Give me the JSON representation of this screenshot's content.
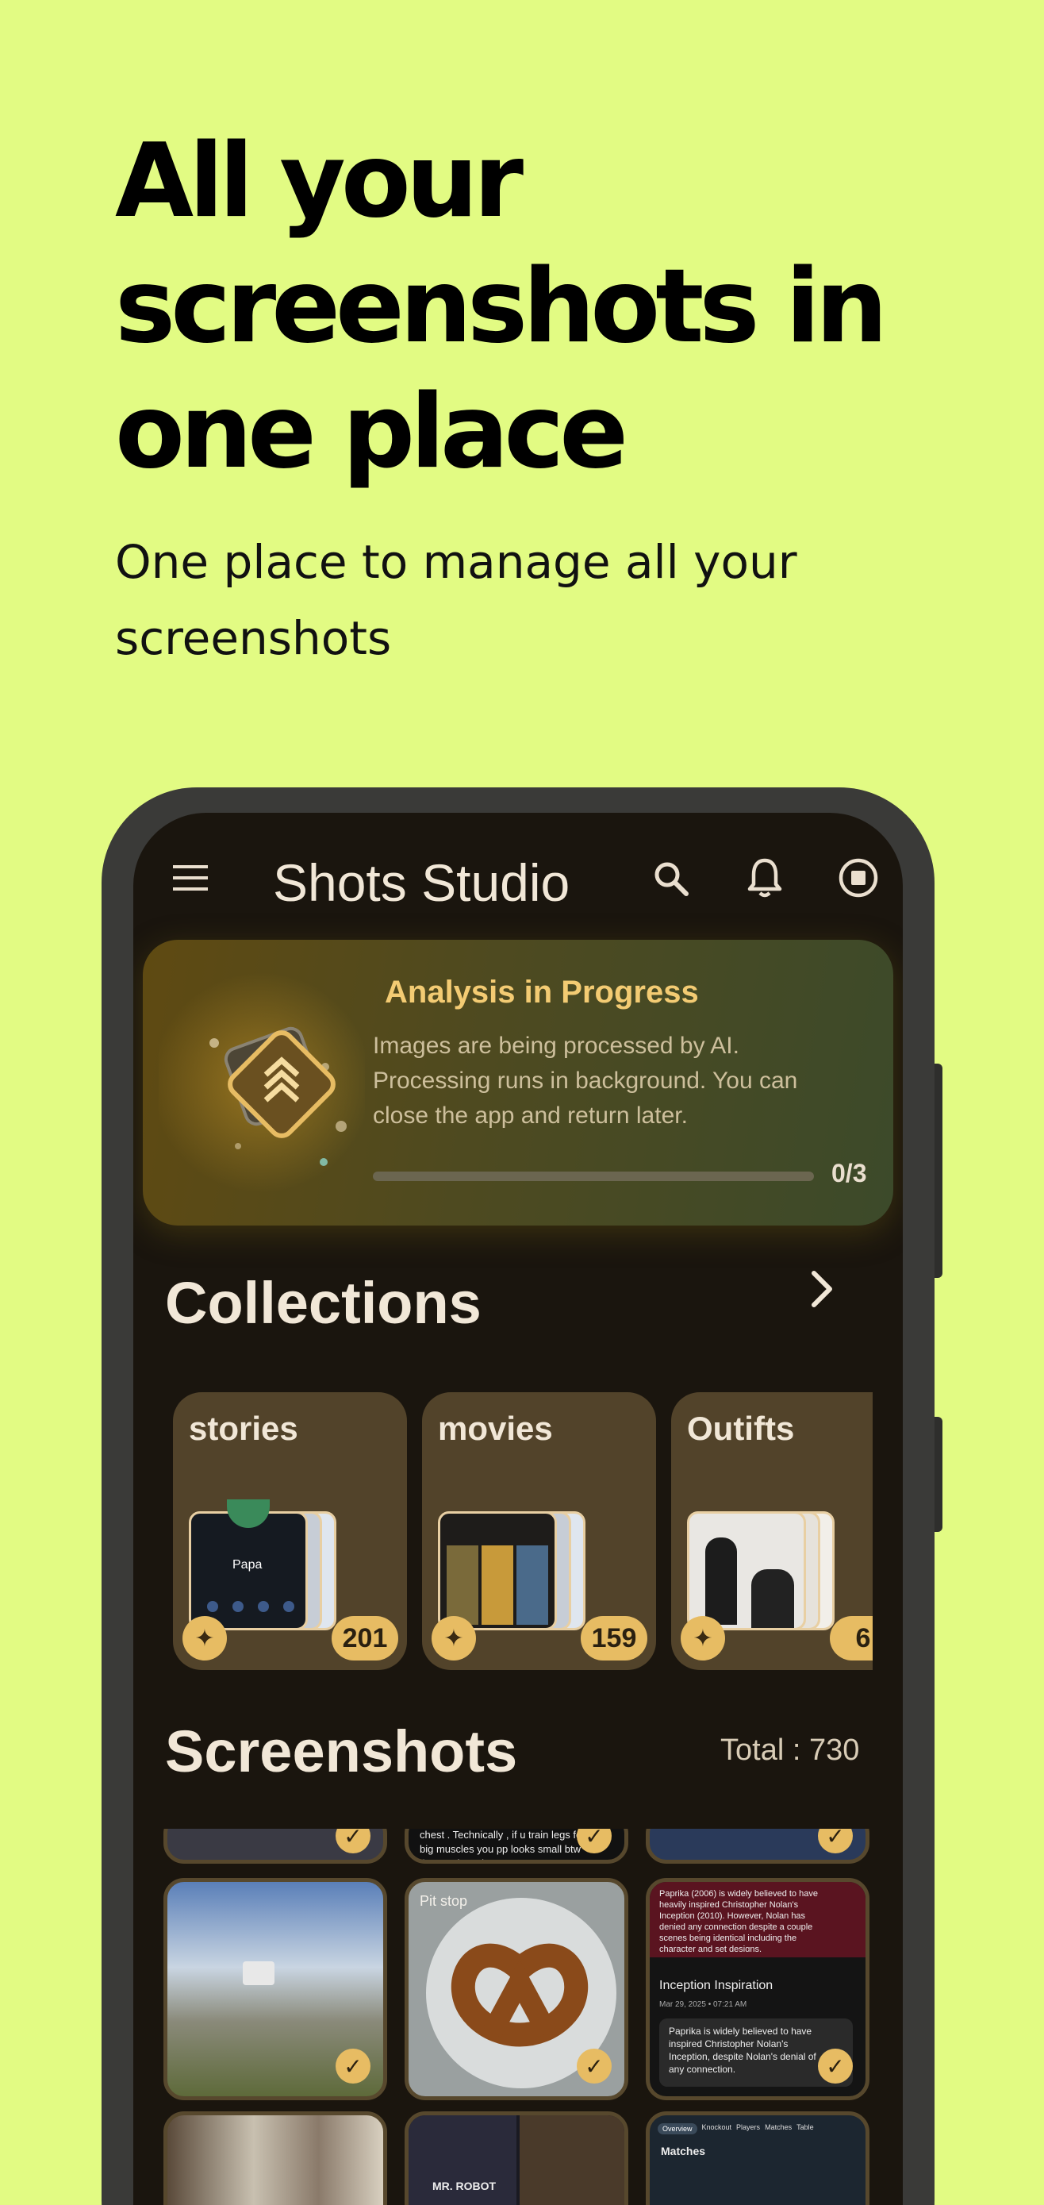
{
  "headline": "All your screenshots in one place",
  "subheadline": "One place to manage all your screenshots",
  "app": {
    "title": "Shots Studio",
    "icons": [
      "menu-icon",
      "search-icon",
      "notification-bell-icon",
      "stop-icon"
    ]
  },
  "analysis": {
    "title": "Analysis in Progress",
    "description": "Images are being processed by AI. Processing runs in background. You can close the app and return later.",
    "progress_text": "0/3",
    "progress_fraction": 0
  },
  "collections": {
    "title": "Collections",
    "items": [
      {
        "name": "stories",
        "count": "201",
        "screen_label": "Papa"
      },
      {
        "name": "movies",
        "count": "159",
        "screen_label": ""
      },
      {
        "name": "Outifts",
        "count": "6",
        "screen_label": ""
      }
    ]
  },
  "screenshots": {
    "title": "Screenshots",
    "total": "Total : 730",
    "tiles": {
      "top_snippet": "chest . Technically , if u train legs for big muscles you pp looks small btw them . That's it",
      "pretzel_caption": "Pit stop",
      "movie_note_title": "Inception Inspiration",
      "movie_note_date": "Mar 29, 2025 • 07:21 AM",
      "movie_note_body": "Paprika is widely believed to have inspired Christopher Nolan's Inception, despite Nolan's denial of any connection.",
      "movie_note_header": "Paprika (2006) is widely believed to have heavily inspired Christopher Nolan's Inception (2010). However, Nolan has denied any connection despite a couple scenes being identical including the character and set designs.",
      "sports_tabs": [
        "Overview",
        "Knockout",
        "Players",
        "Matches",
        "Table"
      ],
      "sports_heading": "Matches",
      "mr_robot": "MR. ROBOT"
    }
  },
  "colors": {
    "background": "#e2fb83",
    "accent": "#e7bc63",
    "screen": "#1a150e"
  }
}
